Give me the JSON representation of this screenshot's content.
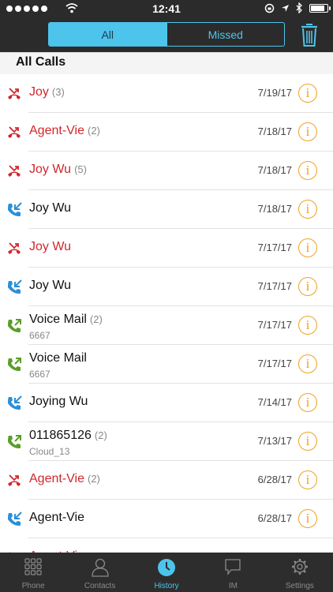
{
  "status": {
    "time": "12:41",
    "battery_level": 0.9
  },
  "header": {
    "tabs": [
      {
        "label": "All",
        "active": true
      },
      {
        "label": "Missed",
        "active": false
      }
    ]
  },
  "section_title": "All Calls",
  "calls": [
    {
      "name": "Joy",
      "count": "(3)",
      "sub": "",
      "date": "7/19/17",
      "type": "missed"
    },
    {
      "name": "Agent-Vie",
      "count": "(2)",
      "sub": "",
      "date": "7/18/17",
      "type": "missed"
    },
    {
      "name": "Joy Wu",
      "count": "(5)",
      "sub": "",
      "date": "7/18/17",
      "type": "missed"
    },
    {
      "name": "Joy Wu",
      "count": "",
      "sub": "",
      "date": "7/18/17",
      "type": "incoming"
    },
    {
      "name": "Joy Wu",
      "count": "",
      "sub": "",
      "date": "7/17/17",
      "type": "missed"
    },
    {
      "name": "Joy Wu",
      "count": "",
      "sub": "",
      "date": "7/17/17",
      "type": "incoming"
    },
    {
      "name": "Voice Mail",
      "count": "(2)",
      "sub": "6667",
      "date": "7/17/17",
      "type": "outgoing"
    },
    {
      "name": "Voice Mail",
      "count": "",
      "sub": "6667",
      "date": "7/17/17",
      "type": "outgoing"
    },
    {
      "name": "Joying Wu",
      "count": "",
      "sub": "",
      "date": "7/14/17",
      "type": "incoming"
    },
    {
      "name": "011865126",
      "count": "(2)",
      "sub": "Cloud_13",
      "date": "7/13/17",
      "type": "outgoing"
    },
    {
      "name": "Agent-Vie",
      "count": "(2)",
      "sub": "",
      "date": "6/28/17",
      "type": "missed"
    },
    {
      "name": "Agent-Vie",
      "count": "",
      "sub": "",
      "date": "6/28/17",
      "type": "incoming"
    },
    {
      "name": "Agent-Vie",
      "count": "",
      "sub": "",
      "date": "",
      "type": "missed"
    }
  ],
  "info_glyph": "i",
  "tabbar": [
    {
      "label": "Phone",
      "icon": "keypad-icon",
      "active": false
    },
    {
      "label": "Contacts",
      "icon": "person-icon",
      "active": false
    },
    {
      "label": "History",
      "icon": "clock-icon",
      "active": true
    },
    {
      "label": "IM",
      "icon": "chat-bubble-icon",
      "active": false
    },
    {
      "label": "Settings",
      "icon": "gear-icon",
      "active": false
    }
  ],
  "colors": {
    "accent": "#4dc4ec",
    "missed": "#d0262c",
    "incoming": "#2a8fd8",
    "outgoing": "#5a9e2a",
    "info": "#f0a11f",
    "bar_bg": "#2b2b2b"
  }
}
